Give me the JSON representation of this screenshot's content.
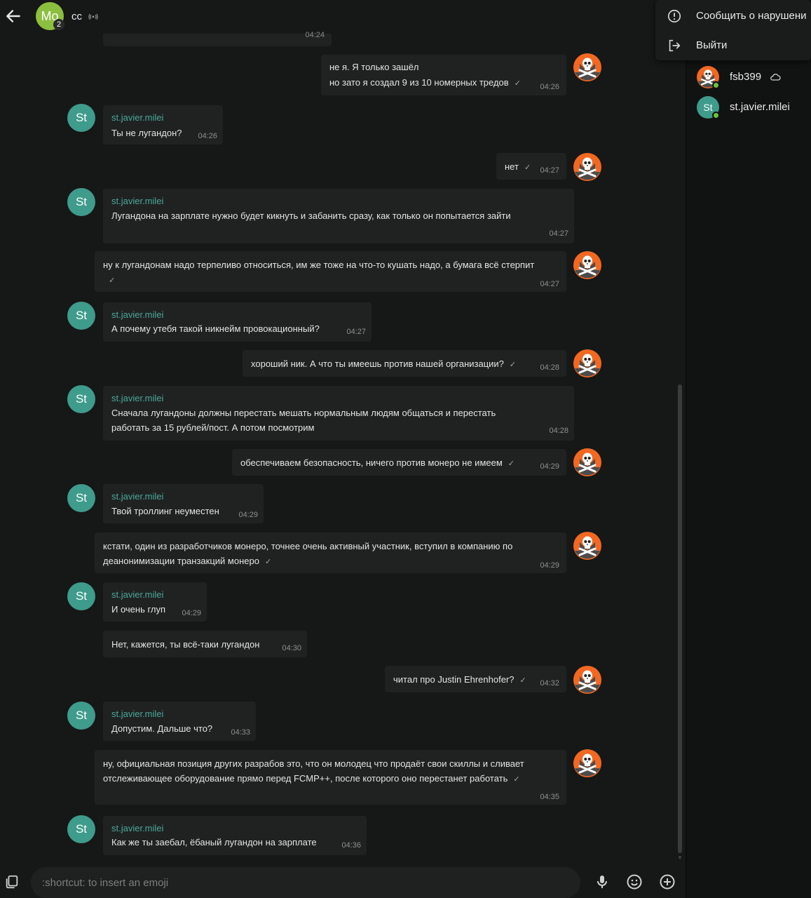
{
  "header": {
    "avatar_initials": "Mo",
    "badge_count": "2",
    "chat_name": "cc",
    "icons": [
      "back-arrow-icon",
      "broadcast-icon"
    ]
  },
  "top_cut_time": "04:24",
  "messages": [
    {
      "side": "out",
      "lines": [
        "не я. Я только зашёл",
        "но зато я создал 9 из 10 номерных тредов"
      ],
      "time": "04:26"
    },
    {
      "side": "in",
      "sender": "st.javier.milei",
      "avatar": "St",
      "text": "Ты не лугандон?",
      "time": "04:26"
    },
    {
      "side": "out",
      "text": "нет",
      "time": "04:27"
    },
    {
      "side": "in",
      "sender": "st.javier.milei",
      "avatar": "St",
      "text": "Лугандона на зарплате нужно будет кикнуть и забанить сразу, как только он попытается зайти",
      "time": "04:27"
    },
    {
      "side": "out",
      "text": "ну к лугандонам надо терпеливо относиться, им же тоже на что-то кушать надо, а бумага всё стерпит",
      "time": "04:27"
    },
    {
      "side": "in",
      "sender": "st.javier.milei",
      "avatar": "St",
      "text": "А почему утебя такой никнейм провокационный?",
      "time": "04:27"
    },
    {
      "side": "out",
      "text": "хороший ник. А что ты имеешь против нашей организации?",
      "time": "04:28"
    },
    {
      "side": "in",
      "sender": "st.javier.milei",
      "avatar": "St",
      "text": "Сначала лугандоны должны перестать мешать нормальным людям общаться и перестать работать за 15 рублей/пост.  А потом посмотрим",
      "time": "04:28"
    },
    {
      "side": "out",
      "text": "обеспечиваем безопасность, ничего против монеро не имеем",
      "time": "04:29"
    },
    {
      "side": "in",
      "sender": "st.javier.milei",
      "avatar": "St",
      "text": "Твой троллинг неуместен",
      "time": "04:29"
    },
    {
      "side": "out",
      "text": "кстати, один из разработчиков монеро, точнее очень активный участник, вступил в компанию по деанонимизации транзакций монеро",
      "time": "04:29"
    },
    {
      "side": "in",
      "sender": "st.javier.milei",
      "avatar": "St",
      "text": "И очень глуп",
      "time": "04:29"
    },
    {
      "side": "in",
      "text": "Нет, кажется, ты всё-таки лугандон",
      "time": "04:30"
    },
    {
      "side": "out",
      "text": "читал про Justin Ehrenhofer?",
      "time": "04:32"
    },
    {
      "side": "in",
      "sender": "st.javier.milei",
      "avatar": "St",
      "text": "Допустим. Дальше что?",
      "time": "04:33"
    },
    {
      "side": "out",
      "text": "ну, официальная позиция других разрабов это, что он молодец что продаёт свои скиллы и сливает отслеживающее оборудование прямо перед FCMP++, после которого оно перестанет работать",
      "time": "04:35"
    },
    {
      "side": "in",
      "sender": "st.javier.milei",
      "avatar": "St",
      "text": "Как же ты заебал, ёбаный лугандон на зарплате",
      "time": "04:36"
    }
  ],
  "composer": {
    "placeholder": ":shortcut: to insert an emoji",
    "icons": [
      "attach-icon",
      "microphone-icon",
      "emoji-icon",
      "add-icon"
    ]
  },
  "context_menu": {
    "items": [
      {
        "label": "Сообщить о нарушени",
        "icon": "report-icon"
      },
      {
        "label": "Выйти",
        "icon": "leave-icon"
      }
    ]
  },
  "members": [
    {
      "name": "fsb399",
      "avatar": "monero-pirate",
      "status": "online",
      "extra_icon": "cloud-icon"
    },
    {
      "name": "st.javier.milei",
      "avatar": "St",
      "status": "online"
    }
  ],
  "colors": {
    "background": "#161717",
    "bubble": "#202222",
    "sender_name": "#4aa89a",
    "avatar_st": "#3f9b8b",
    "avatar_group": "#8cbf3f",
    "online": "#6cc33b",
    "monero_orange": "#f26822"
  }
}
